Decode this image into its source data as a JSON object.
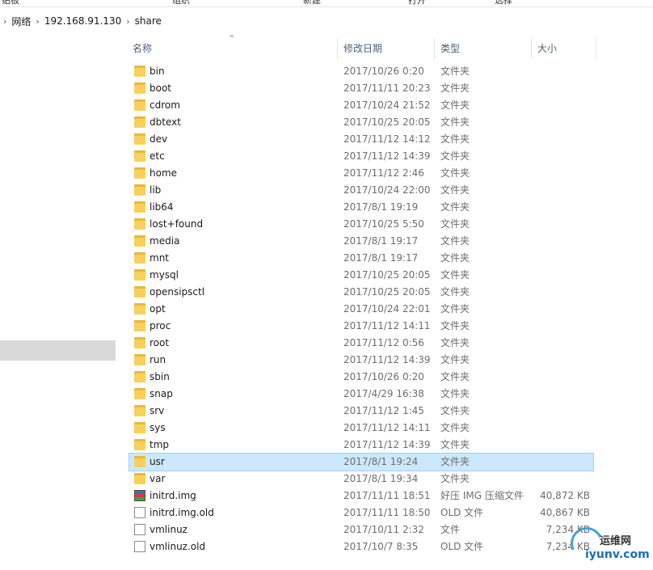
{
  "ribbon": {
    "items": [
      "贴板",
      "组织",
      "新建",
      "打开",
      "选择"
    ]
  },
  "breadcrumb": {
    "items": [
      "网络",
      "192.168.91.130",
      "share"
    ]
  },
  "columns": {
    "name": "名称",
    "date": "修改日期",
    "type": "类型",
    "size": "大小"
  },
  "files": [
    {
      "name": "bin",
      "date": "2017/10/26 0:20",
      "type": "文件夹",
      "size": "",
      "icon": "folder-icon"
    },
    {
      "name": "boot",
      "date": "2017/11/11 20:23",
      "type": "文件夹",
      "size": "",
      "icon": "folder-icon"
    },
    {
      "name": "cdrom",
      "date": "2017/10/24 21:52",
      "type": "文件夹",
      "size": "",
      "icon": "folder-icon"
    },
    {
      "name": "dbtext",
      "date": "2017/10/25 20:05",
      "type": "文件夹",
      "size": "",
      "icon": "folder-icon"
    },
    {
      "name": "dev",
      "date": "2017/11/12 14:12",
      "type": "文件夹",
      "size": "",
      "icon": "folder-icon"
    },
    {
      "name": "etc",
      "date": "2017/11/12 14:39",
      "type": "文件夹",
      "size": "",
      "icon": "folder-icon"
    },
    {
      "name": "home",
      "date": "2017/11/12 2:46",
      "type": "文件夹",
      "size": "",
      "icon": "folder-icon"
    },
    {
      "name": "lib",
      "date": "2017/10/24 22:00",
      "type": "文件夹",
      "size": "",
      "icon": "folder-icon"
    },
    {
      "name": "lib64",
      "date": "2017/8/1 19:19",
      "type": "文件夹",
      "size": "",
      "icon": "folder-icon"
    },
    {
      "name": "lost+found",
      "date": "2017/10/25 5:50",
      "type": "文件夹",
      "size": "",
      "icon": "folder-icon"
    },
    {
      "name": "media",
      "date": "2017/8/1 19:17",
      "type": "文件夹",
      "size": "",
      "icon": "folder-icon"
    },
    {
      "name": "mnt",
      "date": "2017/8/1 19:17",
      "type": "文件夹",
      "size": "",
      "icon": "folder-icon"
    },
    {
      "name": "mysql",
      "date": "2017/10/25 20:05",
      "type": "文件夹",
      "size": "",
      "icon": "folder-icon"
    },
    {
      "name": "opensipsctl",
      "date": "2017/10/25 20:05",
      "type": "文件夹",
      "size": "",
      "icon": "folder-icon"
    },
    {
      "name": "opt",
      "date": "2017/10/24 22:01",
      "type": "文件夹",
      "size": "",
      "icon": "folder-icon"
    },
    {
      "name": "proc",
      "date": "2017/11/12 14:11",
      "type": "文件夹",
      "size": "",
      "icon": "folder-icon"
    },
    {
      "name": "root",
      "date": "2017/11/12 0:56",
      "type": "文件夹",
      "size": "",
      "icon": "folder-icon"
    },
    {
      "name": "run",
      "date": "2017/11/12 14:39",
      "type": "文件夹",
      "size": "",
      "icon": "folder-icon"
    },
    {
      "name": "sbin",
      "date": "2017/10/26 0:20",
      "type": "文件夹",
      "size": "",
      "icon": "folder-icon"
    },
    {
      "name": "snap",
      "date": "2017/4/29 16:38",
      "type": "文件夹",
      "size": "",
      "icon": "folder-icon"
    },
    {
      "name": "srv",
      "date": "2017/11/12 1:45",
      "type": "文件夹",
      "size": "",
      "icon": "folder-icon"
    },
    {
      "name": "sys",
      "date": "2017/11/12 14:11",
      "type": "文件夹",
      "size": "",
      "icon": "folder-icon"
    },
    {
      "name": "tmp",
      "date": "2017/11/12 14:39",
      "type": "文件夹",
      "size": "",
      "icon": "folder-icon"
    },
    {
      "name": "usr",
      "date": "2017/8/1 19:24",
      "type": "文件夹",
      "size": "",
      "icon": "folder-icon",
      "selected": true
    },
    {
      "name": "var",
      "date": "2017/8/1 19:34",
      "type": "文件夹",
      "size": "",
      "icon": "folder-icon"
    },
    {
      "name": "initrd.img",
      "date": "2017/11/11 18:51",
      "type": "好压 IMG 压缩文件",
      "size": "40,872 KB",
      "icon": "archive-icon"
    },
    {
      "name": "initrd.img.old",
      "date": "2017/11/11 18:50",
      "type": "OLD 文件",
      "size": "40,867 KB",
      "icon": "file-icon"
    },
    {
      "name": "vmlinuz",
      "date": "2017/10/11 2:32",
      "type": "文件",
      "size": "7,234 KB",
      "icon": "file-icon"
    },
    {
      "name": "vmlinuz.old",
      "date": "2017/10/7 8:35",
      "type": "OLD 文件",
      "size": "7,234 KB",
      "icon": "file-icon"
    }
  ],
  "watermark": {
    "top": "运维网",
    "bottom": "iyunv.com"
  }
}
